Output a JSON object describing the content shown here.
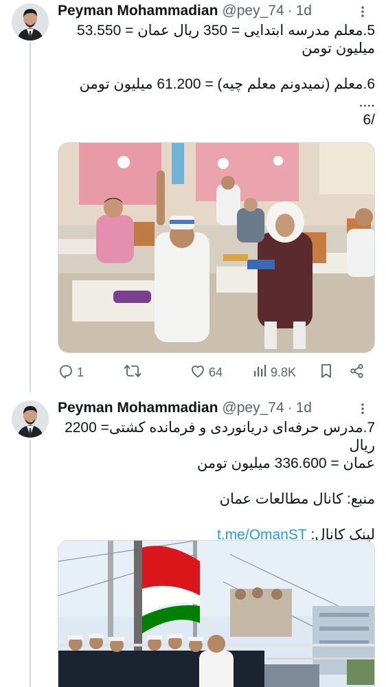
{
  "tweets": [
    {
      "author_name": "Peyman Mohammadian",
      "handle": "@pey_74",
      "separator": "·",
      "time": "1d",
      "lines": [
        "5.معلم مدرسه ابتدایی = 350 ریال عمان = 53.550",
        "میلیون تومن",
        "",
        "6.معلم (نمیدونم معلم چیه) = 61.200 میلیون تومن",
        "....",
        "6/"
      ],
      "image": "classroom-photo",
      "actions": {
        "reply_count": "1",
        "retweet_count": "",
        "like_count": "64",
        "view_count": "9.8K"
      }
    },
    {
      "author_name": "Peyman Mohammadian",
      "handle": "@pey_74",
      "separator": "·",
      "time": "1d",
      "lines": [
        "7.مدرس حرفه‌ای دریانوردی و فرمانده کشتی= 2200 ریال",
        "عمان = 336.600 میلیون تومن",
        "",
        "منبع: کانال مطالعات عمان",
        ""
      ],
      "link_prefix": "لینک کانال: ",
      "link_text": "t.me/OmanST",
      "image": "ship-crew-photo"
    }
  ],
  "colors": {
    "accent": "#1d9bf0",
    "muted": "#536471",
    "border": "#cfd9de",
    "oman_red": "#db161b",
    "oman_green": "#008000"
  },
  "icons": [
    "reply-icon",
    "retweet-icon",
    "like-icon",
    "views-icon",
    "bookmark-icon",
    "share-icon",
    "more-icon"
  ]
}
